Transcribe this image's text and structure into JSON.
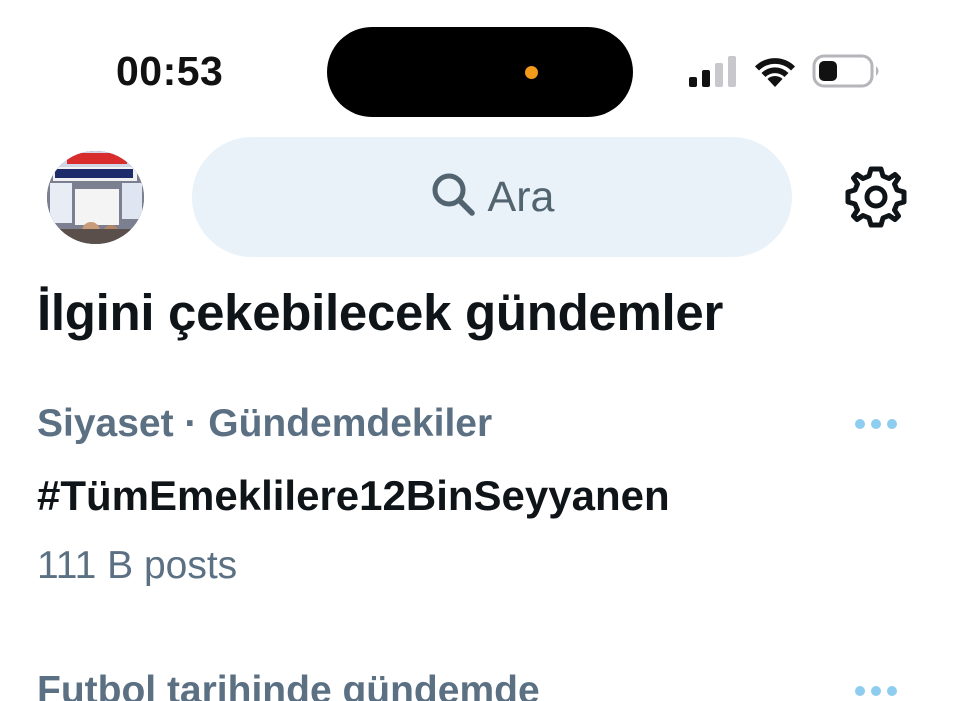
{
  "status_bar": {
    "time": "00:53",
    "camera_indicator_color": "#f29a1b",
    "icons": [
      "signal-icon",
      "wifi-icon",
      "battery-icon"
    ]
  },
  "header": {
    "avatar_icon": "avatar",
    "search": {
      "placeholder": "Ara",
      "icon": "search-icon"
    },
    "settings_icon": "gear-icon"
  },
  "section": {
    "title": "İlgini çekebilecek gündemler"
  },
  "trends": [
    {
      "context": "Siyaset · Gündemdekiler",
      "name": "#TümEmeklilere12BinSeyyanen",
      "count": "111 B posts"
    },
    {
      "context": "Futbol tarihinde gündemde"
    }
  ],
  "colors": {
    "text_primary": "#0f1419",
    "text_secondary": "#5b7083",
    "search_bg": "#e8f2f8",
    "more_dots": "#8ecdf0"
  }
}
